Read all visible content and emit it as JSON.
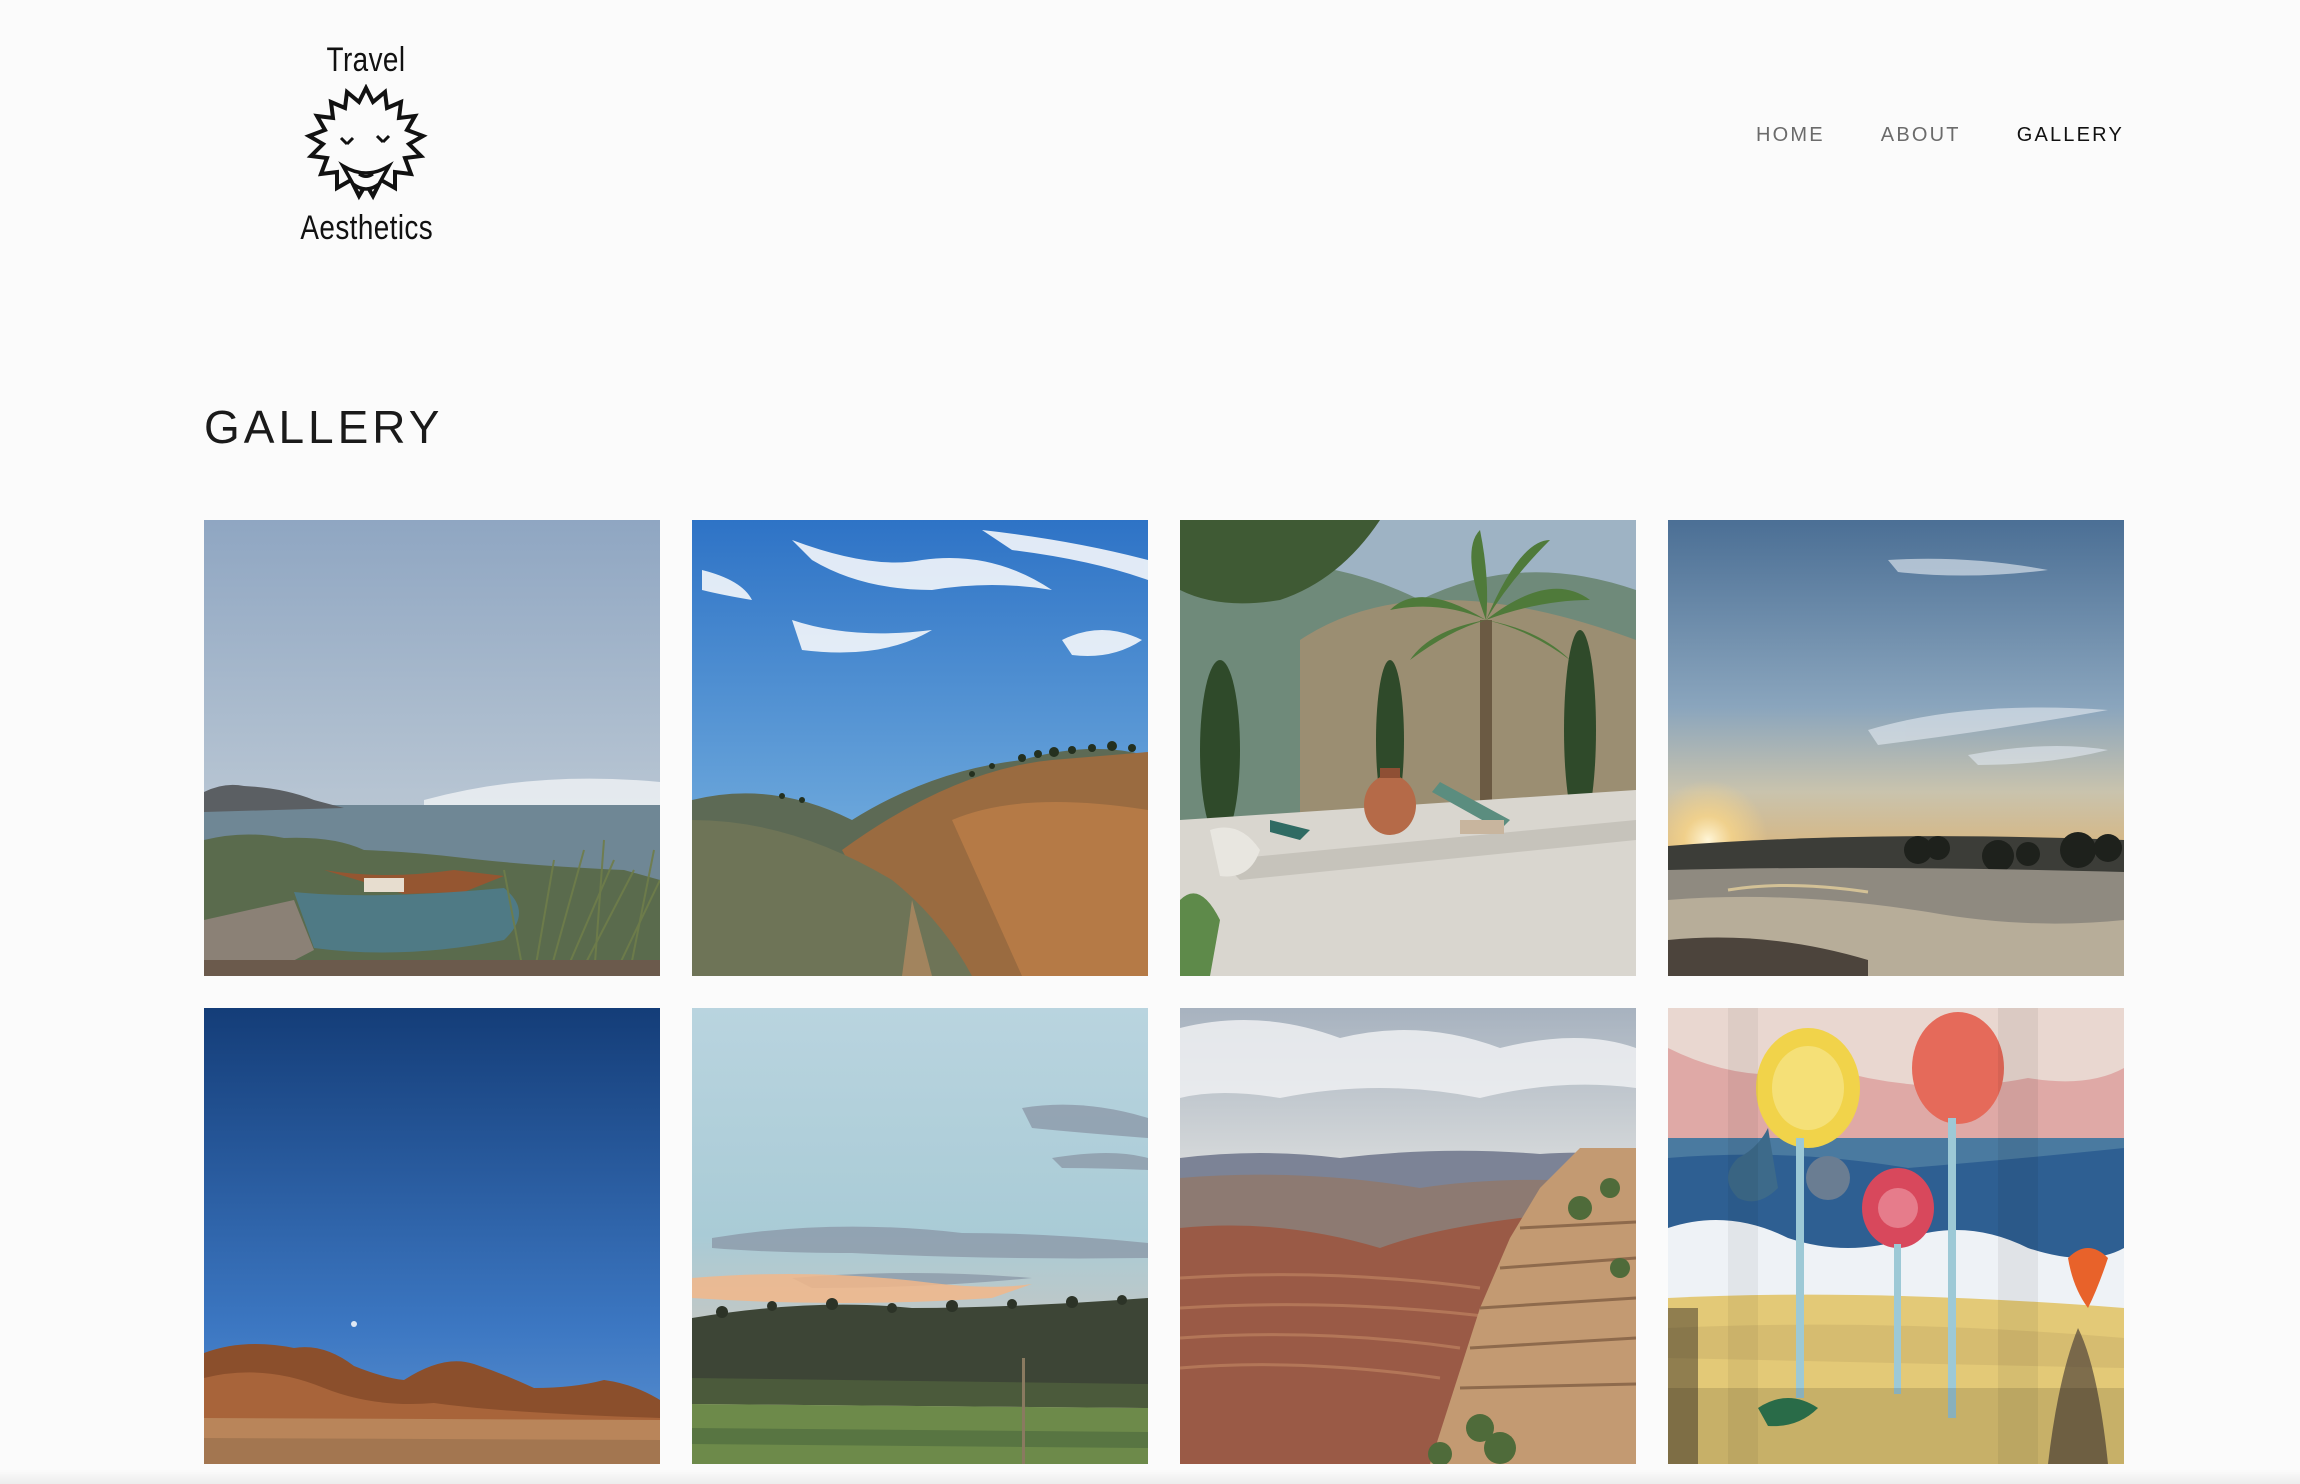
{
  "brand": {
    "line1": "Travel",
    "line2": "Aesthetics",
    "icon": "hedgehog-sun-icon"
  },
  "nav": {
    "items": [
      {
        "label": "HOME"
      },
      {
        "label": "ABOUT"
      },
      {
        "label": "GALLERY",
        "active": true
      }
    ]
  },
  "page": {
    "title": "GALLERY"
  },
  "gallery": {
    "images": [
      {
        "subject": "bay-harbor-view"
      },
      {
        "subject": "golden-hillside-sky"
      },
      {
        "subject": "palm-terrace-urn"
      },
      {
        "subject": "sunset-river"
      },
      {
        "subject": "desert-mountain-blue-sky"
      },
      {
        "subject": "pastel-sky-forest-field"
      },
      {
        "subject": "grand-canyon"
      },
      {
        "subject": "colorful-mural-trees"
      }
    ]
  },
  "colors": {
    "background": "#fbfbfb",
    "nav_inactive": "#6b6b6b",
    "nav_active": "#111111"
  }
}
